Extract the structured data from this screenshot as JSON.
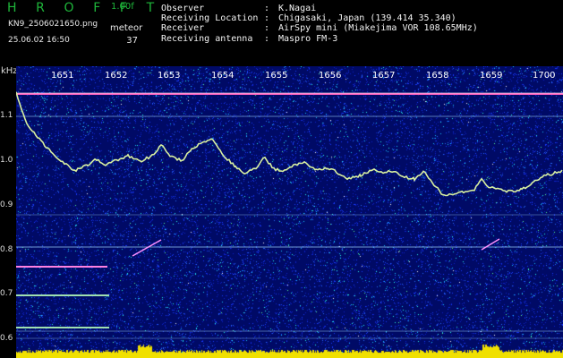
{
  "header": {
    "app_title": "H R O F F T",
    "version": "1.00f",
    "filename": "KN9_2506021650.png",
    "datetime": "25.06.02 16:50",
    "meteor_label": "meteor",
    "meteor_count": "37"
  },
  "station_info": [
    {
      "label": "Observer",
      "colon": ":",
      "value": "K.Nagai"
    },
    {
      "label": "Receiving Location",
      "colon": ":",
      "value": "Chigasaki, Japan (139.414 35.340)"
    },
    {
      "label": "Receiver",
      "colon": ":",
      "value": "AirSpy mini (Miakejima VOR 108.65MHz)"
    },
    {
      "label": "Receiving antenna",
      "colon": ":",
      "value": "Maspro FM-3"
    }
  ],
  "spectrogram": {
    "freq_unit": "kHz",
    "y_ticks": [
      "1.1",
      "1.0",
      "0.9",
      "0.8",
      "0.7",
      "0.6"
    ],
    "time_ticks": [
      "1651",
      "1652",
      "1653",
      "1654",
      "1655",
      "1656",
      "1657",
      "1658",
      "1659",
      "1700"
    ],
    "colors": {
      "background": "#000a66",
      "signal": "#d8f0a0",
      "baseline_band": "#f0e000",
      "carrier": "#ff60c0"
    }
  }
}
